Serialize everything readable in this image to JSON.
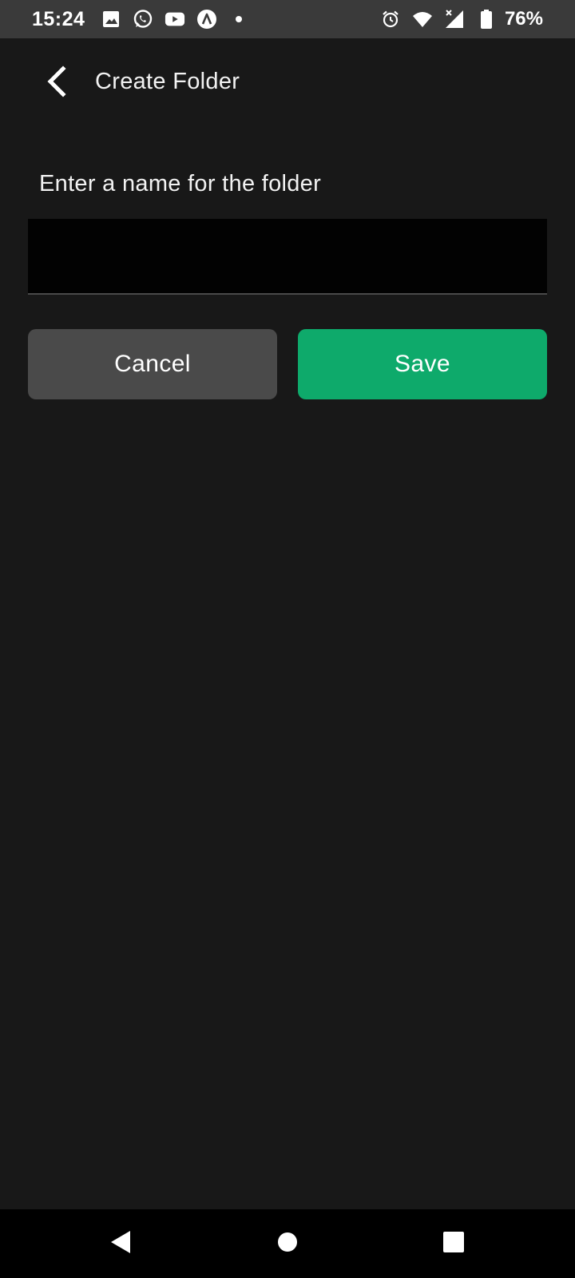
{
  "status_bar": {
    "time": "15:24",
    "left_icons": [
      "gallery-icon",
      "whatsapp-icon",
      "youtube-icon",
      "arc-app-icon",
      "notification-dot-icon"
    ],
    "right_icons": [
      "alarm-icon",
      "wifi-icon",
      "cell-signal-icon",
      "battery-icon"
    ],
    "battery_percent": "76%"
  },
  "header": {
    "title": "Create Folder",
    "back_icon": "chevron-left-icon"
  },
  "form": {
    "label": "Enter a name for the folder",
    "input_value": "",
    "input_placeholder": ""
  },
  "actions": {
    "cancel_label": "Cancel",
    "save_label": "Save"
  },
  "colors": {
    "background": "#181818",
    "status_bar": "#3a3a3a",
    "input_background": "#020202",
    "cancel_button": "#4a4a4a",
    "save_button": "#0eaa6b",
    "nav_bar": "#000000"
  },
  "nav_bar": {
    "buttons": [
      "back-triangle-icon",
      "home-circle-icon",
      "recents-square-icon"
    ]
  }
}
